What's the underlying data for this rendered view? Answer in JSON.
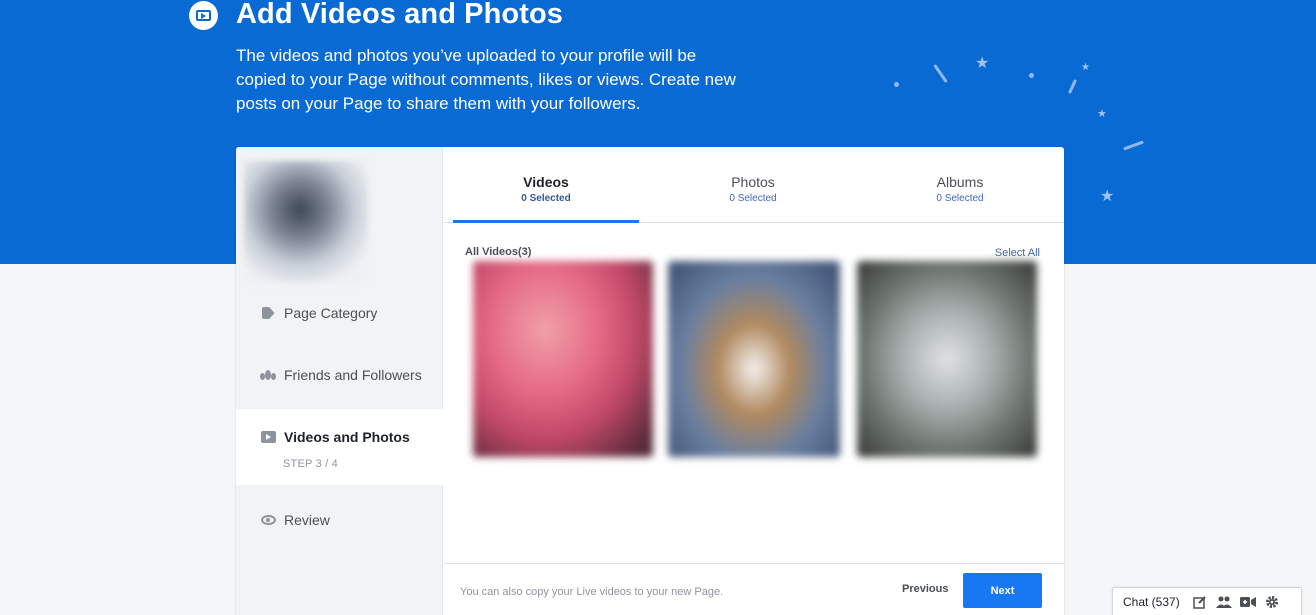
{
  "hero": {
    "title": "Add Videos and Photos",
    "description": "The videos and photos you’ve uploaded to your profile will be copied to your Page without comments, likes or views. Create new posts on your Page to share them with your followers."
  },
  "sidebar": {
    "items": [
      {
        "label": "Page Category",
        "icon": "tag-icon"
      },
      {
        "label": "Friends and Followers",
        "icon": "people-icon"
      },
      {
        "label": "Videos and Photos",
        "icon": "video-icon",
        "active": true,
        "step": "STEP 3 / 4"
      },
      {
        "label": "Review",
        "icon": "eye-icon"
      }
    ]
  },
  "tabs": [
    {
      "label": "Videos",
      "sub": "0 Selected",
      "active": true
    },
    {
      "label": "Photos",
      "sub": "0 Selected"
    },
    {
      "label": "Albums",
      "sub": "0 Selected"
    }
  ],
  "content": {
    "section_title": "All Videos(3)",
    "select_all": "Select All"
  },
  "footer": {
    "note": "You can also copy your Live videos to your new Page.",
    "previous": "Previous",
    "next": "Next"
  },
  "chat": {
    "label": "Chat (537)",
    "icons": [
      "compose-icon",
      "people-icon",
      "video-call-icon",
      "gear-icon"
    ]
  },
  "colors": {
    "hero_bg": "#0a6ad3",
    "accent": "#1877f2",
    "link": "#4267b2"
  }
}
